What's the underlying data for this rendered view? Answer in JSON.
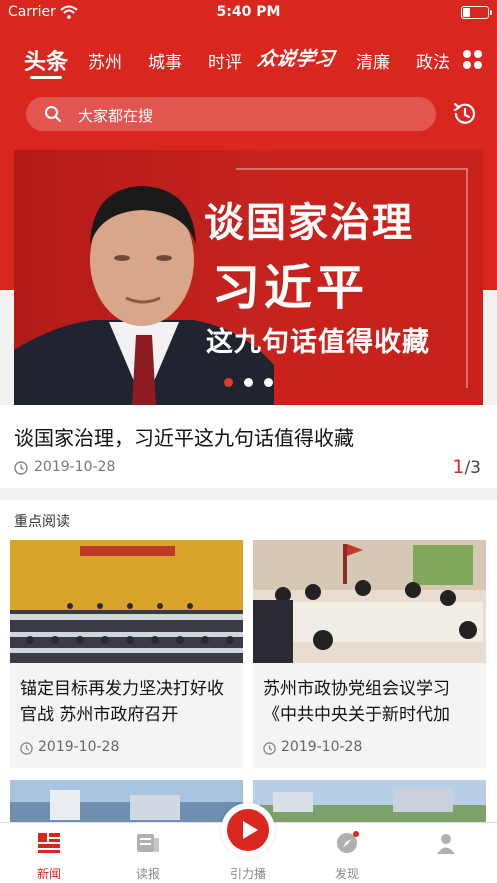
{
  "status_bar": {
    "carrier": "Carrier",
    "time": "5:40 PM"
  },
  "tabs": {
    "items": [
      {
        "label": "头条",
        "active": true
      },
      {
        "label": "苏州"
      },
      {
        "label": "城事"
      },
      {
        "label": "时评"
      },
      {
        "label": "众说学习"
      },
      {
        "label": "清廉"
      },
      {
        "label": "政法"
      }
    ]
  },
  "search": {
    "placeholder": "大家都在搜"
  },
  "banner": {
    "line1": "谈国家治理",
    "line2": "习近平",
    "line3": "这九句话值得收藏",
    "dots": 3,
    "active_dot": 0
  },
  "headline": {
    "title": "谈国家治理，习近平这九句话值得收藏",
    "date": "2019-10-28",
    "pager_current": "1",
    "pager_total": "/3"
  },
  "section": {
    "title": "重点阅读",
    "cards": [
      {
        "title": "锚定目标再发力坚决打好收官战 苏州市政府召开",
        "date": "2019-10-28"
      },
      {
        "title": "苏州市政协党组会议学习《中共中央关于新时代加",
        "date": "2019-10-28"
      }
    ]
  },
  "bottom_nav": {
    "items": [
      {
        "label": "新闻",
        "active": true
      },
      {
        "label": "读报"
      },
      {
        "label": "引力播"
      },
      {
        "label": "发现"
      },
      {
        "label": ""
      }
    ]
  },
  "colors": {
    "brand_red": "#d9271f"
  }
}
